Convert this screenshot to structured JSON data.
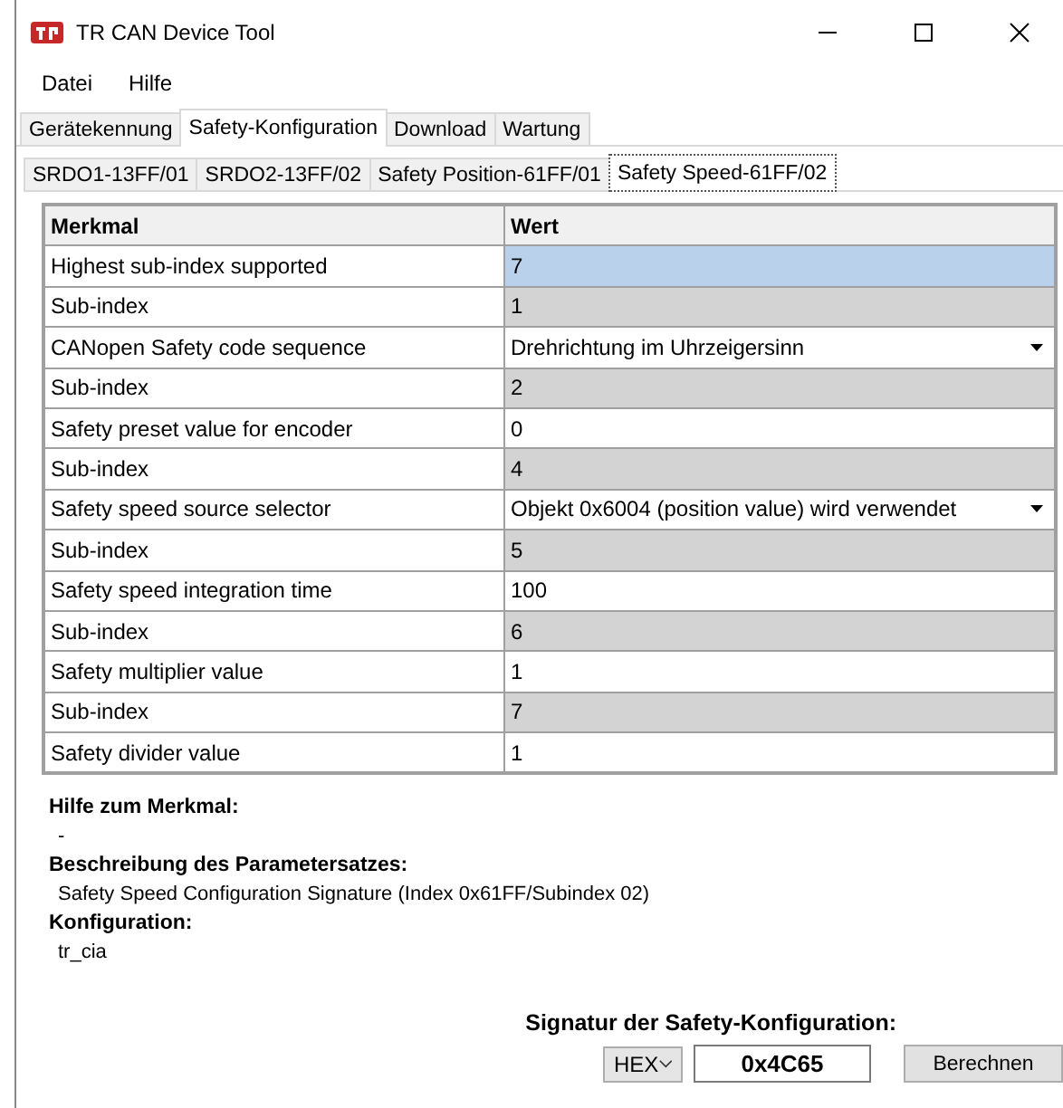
{
  "window": {
    "title": "TR CAN Device Tool"
  },
  "menu": [
    "Datei",
    "Hilfe"
  ],
  "tabs": [
    {
      "label": "Gerätekennung",
      "selected": false
    },
    {
      "label": "Safety-Konfiguration",
      "selected": true
    },
    {
      "label": "Download",
      "selected": false
    },
    {
      "label": "Wartung",
      "selected": false
    }
  ],
  "subtabs": [
    {
      "label": "SRDO1-13FF/01",
      "selected": false
    },
    {
      "label": "SRDO2-13FF/02",
      "selected": false
    },
    {
      "label": "Safety Position-61FF/01",
      "selected": false
    },
    {
      "label": "Safety Speed-61FF/02",
      "selected": true
    }
  ],
  "table": {
    "columns": [
      "Merkmal",
      "Wert"
    ],
    "rows": [
      {
        "name": "Highest sub-index supported",
        "value": "7",
        "kind": "readonly",
        "selected": true
      },
      {
        "name": "Sub-index",
        "value": "1",
        "kind": "readonly",
        "selected": false
      },
      {
        "name": "CANopen Safety code sequence",
        "value": "Drehrichtung im Uhrzeigersinn",
        "kind": "dropdown",
        "selected": false
      },
      {
        "name": "Sub-index",
        "value": "2",
        "kind": "readonly",
        "selected": false
      },
      {
        "name": "Safety preset value for encoder",
        "value": "0",
        "kind": "text",
        "selected": false
      },
      {
        "name": "Sub-index",
        "value": "4",
        "kind": "readonly",
        "selected": false
      },
      {
        "name": "Safety speed source selector",
        "value": "Objekt 0x6004 (position value) wird verwendet",
        "kind": "dropdown",
        "selected": false
      },
      {
        "name": "Sub-index",
        "value": "5",
        "kind": "readonly",
        "selected": false
      },
      {
        "name": "Safety speed integration time",
        "value": "100",
        "kind": "text",
        "selected": false
      },
      {
        "name": "Sub-index",
        "value": "6",
        "kind": "readonly",
        "selected": false
      },
      {
        "name": "Safety multiplier value",
        "value": "1",
        "kind": "text",
        "selected": false
      },
      {
        "name": "Sub-index",
        "value": "7",
        "kind": "readonly",
        "selected": false
      },
      {
        "name": "Safety divider value",
        "value": "1",
        "kind": "text",
        "selected": false
      }
    ]
  },
  "info": [
    {
      "heading": "Hilfe zum Merkmal:",
      "text": "-"
    },
    {
      "heading": "Beschreibung des Parametersatzes:",
      "text": "Safety Speed Configuration Signature (Index 0x61FF/Subindex 02)"
    },
    {
      "heading": "Konfiguration:",
      "text": "tr_cia"
    }
  ],
  "signature": {
    "label": "Signatur der Safety-Konfiguration:",
    "format": "HEX",
    "value": "0x4C65",
    "button": "Berechnen"
  }
}
